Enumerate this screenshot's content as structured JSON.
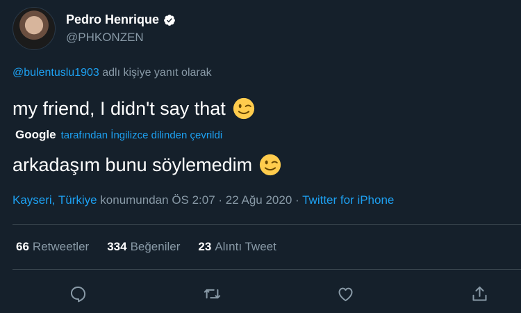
{
  "user": {
    "display_name": "Pedro Henrique",
    "handle": "@PHKONZEN",
    "verified": true
  },
  "reply": {
    "mention": "@bulentuslu1903",
    "suffix": " adlı kişiye yanıt olarak"
  },
  "tweet": {
    "text": "my friend, I didn't say that",
    "emoji": "winking-face"
  },
  "translation": {
    "provider": "Google",
    "note": "tarafından İngilizce dilinden çevrildi",
    "text": "arkadaşım bunu söylemedim"
  },
  "meta": {
    "location": "Kayseri, Türkiye",
    "location_suffix": " konumundan ",
    "time": "ÖS 2:07",
    "separator": " · ",
    "date": "22 Ağu 2020",
    "source": "Twitter for iPhone"
  },
  "stats": {
    "retweets_count": "66",
    "retweets_label": "Retweetler",
    "likes_count": "334",
    "likes_label": "Beğeniler",
    "quotes_count": "23",
    "quotes_label": "Alıntı Tweet"
  },
  "actions": [
    "reply-icon",
    "retweet-icon",
    "like-icon",
    "share-icon"
  ],
  "colors": {
    "background": "#15202b",
    "accent": "#1da1f2",
    "secondary_text": "#8899a6",
    "divider": "#38444d"
  }
}
